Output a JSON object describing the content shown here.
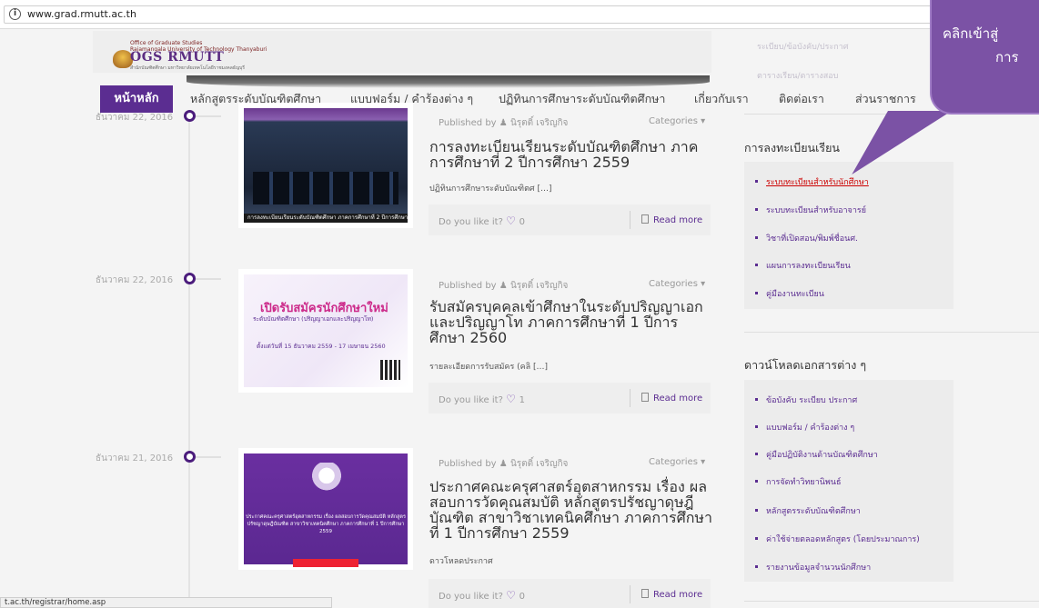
{
  "browser": {
    "url": "www.grad.rmutt.ac.th",
    "status_url": "t.ac.th/registrar/home.asp"
  },
  "header": {
    "logo_small": "Office of Graduate Studies",
    "logo_small2": "Rajamangala University of Technology Thanyaburi",
    "logo_text": "OGS RMUTT",
    "logo_sub": "สำนักบัณฑิตศึกษา มหาวิทยาลัยเทคโนโลยีราชมงคลธัญบุรี"
  },
  "nav": {
    "home": "หน้าหลัก",
    "items": [
      "หลักสูตรระดับบัณฑิตศึกษา",
      "แบบฟอร์ม / คำร้องต่าง ๆ",
      "ปฏิทินการศึกษาระดับบัณฑิตศึกษา",
      "เกี่ยวกับเรา",
      "ติดต่อเรา",
      "ส่วนราชการ"
    ]
  },
  "posts": [
    {
      "date": "ธันวาคม 22, 2016",
      "author": "นิรุตติ์ เจริญกิจ",
      "published_by": "Published by",
      "categories": "Categories",
      "title": "การลงทะเบียนเรียนระดับบัณฑิตศึกษา ภาคการศึกษาที่ 2 ปีการศึกษา 2559",
      "excerpt": "ปฏิทินการศึกษาระดับบัณฑิตศ […]",
      "like_label": "Do you like it?",
      "likes": "0",
      "read_more": "Read more",
      "thumb_caption": "การลงทะเบียนเรียนระดับบัณฑิตศึกษา ภาคการศึกษาที่ 2 ปีการศึกษา 2559"
    },
    {
      "date": "ธันวาคม 22, 2016",
      "author": "นิรุตติ์ เจริญกิจ",
      "published_by": "Published by",
      "categories": "Categories",
      "title": "รับสมัครบุคคลเข้าศึกษาในระดับปริญญาเอกและปริญญาโท ภาคการศึกษาที่ 1 ปีการศึกษา 2560",
      "excerpt": "รายละเอียดการรับสมัคร (คลิ […]",
      "like_label": "Do you like it?",
      "likes": "1",
      "read_more": "Read more",
      "thumb_title": "เปิดรับสมัครนักศึกษาใหม่",
      "thumb_sub": "ระดับบัณฑิตศึกษา (ปริญญาเอกและปริญญาโท)",
      "thumb_dates": "ตั้งแต่วันที่ 15 ธันวาคม 2559 - 17 เมษายน 2560"
    },
    {
      "date": "ธันวาคม 21, 2016",
      "author": "นิรุตติ์ เจริญกิจ",
      "published_by": "Published by",
      "categories": "Categories",
      "title": "ประกาศคณะครุศาสตร์อุตสาหกรรม เรื่อง ผลสอบการวัดคุณสมบัติ หลักสูตรปรัชญาดุษฎีบัณฑิต สาขาวิชาเทคนิคศึกษา ภาคการศึกษาที่ 1 ปีการศึกษา 2559",
      "excerpt": "ดาวโหลดประกาศ",
      "like_label": "Do you like it?",
      "likes": "0",
      "read_more": "Read more",
      "thumb_text": "ประกาศคณะครุศาสตร์อุตสาหกรรม เรื่อง ผลสอบการวัดคุณสมบัติ หลักสูตรปรัชญาดุษฎีบัณฑิต สาขาวิชาเทคนิคศึกษา ภาคการศึกษาที่ 1 ปีการศึกษา 2559"
    }
  ],
  "sidebar": {
    "faded_links": [
      "ระเบียบ/ข้อบังคับ/ประกาศ",
      "ตารางเรียน/ตารางสอบ"
    ],
    "registration": {
      "title": "การลงทะเบียนเรียน",
      "links": [
        "ระบบทะเบียนสำหรับนักศึกษา",
        "ระบบทะเบียนสำหรับอาจารย์",
        "วิชาที่เปิดสอน/พิมพ์ชื่อนศ.",
        "แผนการลงทะเบียนเรียน",
        "คู่มืองานทะเบียน"
      ]
    },
    "downloads": {
      "title": "ดาวน์โหลดเอกสารต่าง ๆ",
      "links": [
        "ข้อบังคับ ระเบียบ ประกาศ",
        "แบบฟอร์ม / คำร้องต่าง ๆ",
        "คู่มือปฏิบัติงานด้านบัณฑิตศึกษา",
        "การจัดทำวิทยานิพนธ์",
        "หลักสูตรระดับบัณฑิตศึกษา",
        "ค่าใช้จ่ายตลอดหลักสูตร (โดยประมาณการ)",
        "รายงานข้อมูลจำนวนนักศึกษา"
      ]
    }
  },
  "callout": {
    "line1": "คลิกเข้าสู่",
    "line2": "การ"
  },
  "colors": {
    "brand_purple": "#5b2d91",
    "callout_purple": "#7b52a5",
    "active_link": "#cc0000"
  }
}
